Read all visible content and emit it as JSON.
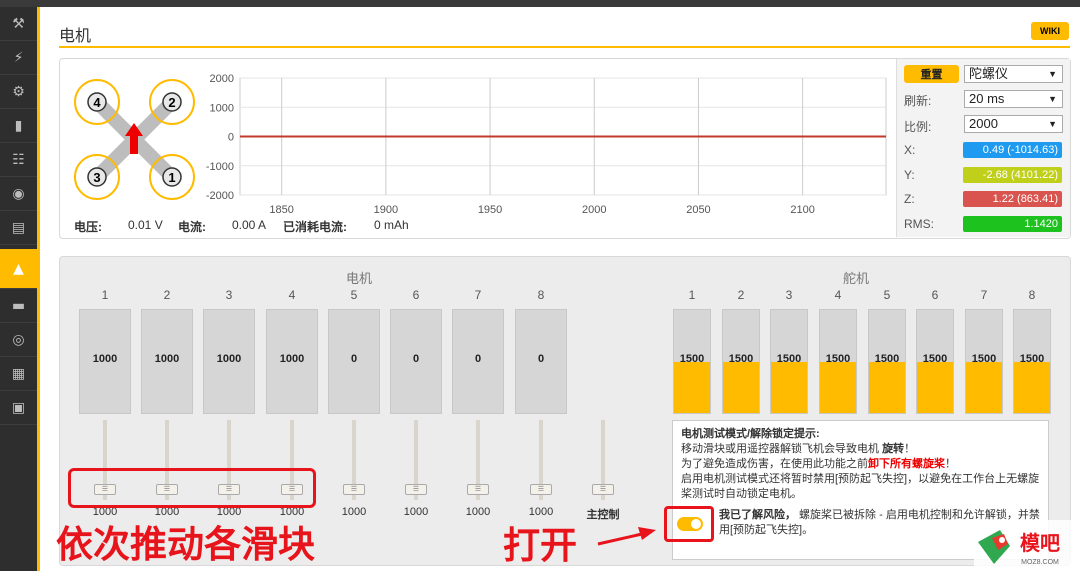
{
  "page": {
    "title": "电机",
    "wiki_label": "WIKI"
  },
  "sidebar": {
    "items": [
      "wrench-icon",
      "plug-icon",
      "gear-icon",
      "battery-icon",
      "network-icon",
      "robot-icon",
      "toggle-icon",
      "motor-icon",
      "osd-icon",
      "wireless-icon",
      "chip-icon",
      "window-icon"
    ],
    "active_index": 7
  },
  "sensor": {
    "reset_label": "重置",
    "sensor_type": "陀螺仪",
    "refresh_label": "刷新:",
    "refresh_value": "20 ms",
    "scale_label": "比例:",
    "scale_value": "2000",
    "x_label": "X:",
    "x_value": "0.49 (-1014.63)",
    "x_color": "#1e9bf0",
    "y_label": "Y:",
    "y_value": "-2.68 (4101.22)",
    "y_color": "#bfcf1a",
    "z_label": "Z:",
    "z_value": "1.22 (863.41)",
    "z_color": "#d9534f",
    "rms_label": "RMS:",
    "rms_value": "1.1420",
    "rms_color": "#1ec21e"
  },
  "quad": {
    "motors": [
      "4",
      "2",
      "3",
      "1"
    ]
  },
  "chart_data": {
    "type": "line",
    "x": [
      1830,
      2140
    ],
    "series": [
      {
        "values": [
          0,
          0
        ],
        "color": "#c0392b"
      }
    ],
    "xticks": [
      "1850",
      "1900",
      "1950",
      "2000",
      "2050",
      "2100"
    ],
    "yticks": [
      "2000",
      "1000",
      "0",
      "-1000",
      "-2000"
    ],
    "xlim": [
      1830,
      2140
    ],
    "ylim": [
      -2000,
      2000
    ],
    "grid": true
  },
  "power": {
    "voltage_label": "电压:",
    "voltage_value": "0.01 V",
    "current_label": "电流:",
    "current_value": "0.00 A",
    "consumed_label": "已消耗电流:",
    "consumed_value": "0 mAh"
  },
  "motors": {
    "title": "电机",
    "items": [
      {
        "num": "1",
        "value": "1000",
        "slider": "1000"
      },
      {
        "num": "2",
        "value": "1000",
        "slider": "1000"
      },
      {
        "num": "3",
        "value": "1000",
        "slider": "1000"
      },
      {
        "num": "4",
        "value": "1000",
        "slider": "1000"
      },
      {
        "num": "5",
        "value": "0",
        "slider": "1000"
      },
      {
        "num": "6",
        "value": "0",
        "slider": "1000"
      },
      {
        "num": "7",
        "value": "0",
        "slider": "1000"
      },
      {
        "num": "8",
        "value": "0",
        "slider": "1000"
      }
    ],
    "master_label": "主控制"
  },
  "servos": {
    "title": "舵机",
    "items": [
      {
        "num": "1",
        "value": "1500",
        "level": 0.5
      },
      {
        "num": "2",
        "value": "1500",
        "level": 0.5
      },
      {
        "num": "3",
        "value": "1500",
        "level": 0.5
      },
      {
        "num": "4",
        "value": "1500",
        "level": 0.5
      },
      {
        "num": "5",
        "value": "1500",
        "level": 0.5
      },
      {
        "num": "6",
        "value": "1500",
        "level": 0.5
      },
      {
        "num": "7",
        "value": "1500",
        "level": 0.5
      },
      {
        "num": "8",
        "value": "1500",
        "level": 0.5
      }
    ]
  },
  "notice": {
    "title": "电机测试模式/解除锁定提示:",
    "line1a": "移动滑块或用遥控器解锁飞机会导致电机 ",
    "line1b": "旋转",
    "line1c": "！",
    "line2a": "为了避免造成伤害，在使用此功能之前",
    "line2b": "卸下所有螺旋桨",
    "line2c": "！",
    "line3": "启用电机测试模式还将暂时禁用[预防起飞失控]，以避免在工作台上无螺旋桨测试时自动锁定电机。",
    "ack_bold": "我已了解风险，",
    "ack_rest": " 螺旋桨已被拆除 - 启用电机控制和允许解锁，并禁用[预防起飞失控]。"
  },
  "annotations": {
    "left": "依次推动各滑块",
    "right": "打开"
  },
  "watermark": {
    "brand": "模吧",
    "url": "MOZ8.COM"
  }
}
